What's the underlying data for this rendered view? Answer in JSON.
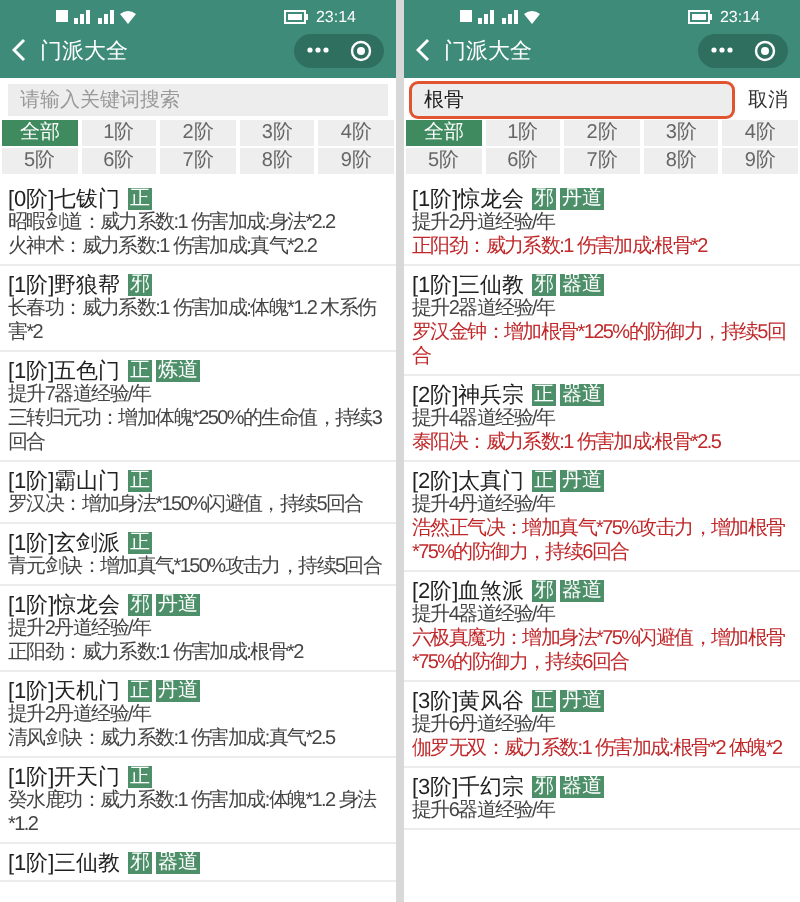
{
  "screens": [
    {
      "status_bar": {
        "time": "23:14"
      },
      "title": "门派大全",
      "search": {
        "placeholder": "请输入关键词搜索"
      },
      "tiers": [
        {
          "label": "全部",
          "selected": true
        },
        {
          "label": "1阶",
          "selected": false
        },
        {
          "label": "2阶",
          "selected": false
        },
        {
          "label": "3阶",
          "selected": false
        },
        {
          "label": "4阶",
          "selected": false
        },
        {
          "label": "5阶",
          "selected": false
        },
        {
          "label": "6阶",
          "selected": false
        },
        {
          "label": "7阶",
          "selected": false
        },
        {
          "label": "8阶",
          "selected": false
        },
        {
          "label": "9阶",
          "selected": false
        }
      ],
      "sects": [
        {
          "title": "[0阶]七钹门",
          "tags": [
            "正"
          ],
          "lines": [
            {
              "text": "昭暇剑道：威力系数:1 伤害加成:身法*2.2",
              "highlight": false
            },
            {
              "text": "火神术：威力系数:1 伤害加成:真气*2.2",
              "highlight": false
            }
          ]
        },
        {
          "title": "[1阶]野狼帮",
          "tags": [
            "邪"
          ],
          "lines": [
            {
              "text": "长春功：威力系数:1 伤害加成:体魄*1.2 木系伤害*2",
              "highlight": false
            }
          ]
        },
        {
          "title": "[1阶]五色门",
          "tags": [
            "正",
            "炼道"
          ],
          "lines": [
            {
              "text": "提升7器道经验/年",
              "highlight": false
            },
            {
              "text": "三转归元功：增加体魄*250%的生命值，持续3回合",
              "highlight": false
            }
          ]
        },
        {
          "title": "[1阶]霸山门",
          "tags": [
            "正"
          ],
          "lines": [
            {
              "text": "罗汉决：增加身法*150%闪避值，持续5回合",
              "highlight": false
            }
          ]
        },
        {
          "title": "[1阶]玄剑派",
          "tags": [
            "正"
          ],
          "lines": [
            {
              "text": "青元剑诀：增加真气*150%攻击力，持续5回合",
              "highlight": false
            }
          ]
        },
        {
          "title": "[1阶]惊龙会",
          "tags": [
            "邪",
            "丹道"
          ],
          "lines": [
            {
              "text": "提升2丹道经验/年",
              "highlight": false
            },
            {
              "text": "正阳劲：威力系数:1 伤害加成:根骨*2",
              "highlight": false
            }
          ]
        },
        {
          "title": "[1阶]天机门",
          "tags": [
            "正",
            "丹道"
          ],
          "lines": [
            {
              "text": "提升2丹道经验/年",
              "highlight": false
            },
            {
              "text": "清风剑诀：威力系数:1 伤害加成:真气*2.5",
              "highlight": false
            }
          ]
        },
        {
          "title": "[1阶]开天门",
          "tags": [
            "正"
          ],
          "lines": [
            {
              "text": "癸水鹿功：威力系数:1 伤害加成:体魄*1.2 身法*1.2",
              "highlight": false
            }
          ]
        },
        {
          "title": "[1阶]三仙教",
          "tags": [
            "邪",
            "器道"
          ]
        }
      ]
    },
    {
      "status_bar": {
        "time": "23:14"
      },
      "title": "门派大全",
      "search": {
        "value": "根骨",
        "focused": true,
        "cancel": "取消"
      },
      "tiers": [
        {
          "label": "全部",
          "selected": true
        },
        {
          "label": "1阶",
          "selected": false
        },
        {
          "label": "2阶",
          "selected": false
        },
        {
          "label": "3阶",
          "selected": false
        },
        {
          "label": "4阶",
          "selected": false
        },
        {
          "label": "5阶",
          "selected": false
        },
        {
          "label": "6阶",
          "selected": false
        },
        {
          "label": "7阶",
          "selected": false
        },
        {
          "label": "8阶",
          "selected": false
        },
        {
          "label": "9阶",
          "selected": false
        }
      ],
      "sects": [
        {
          "title": "[1阶]惊龙会",
          "tags": [
            "邪",
            "丹道"
          ],
          "lines": [
            {
              "text": "提升2丹道经验/年",
              "highlight": false
            },
            {
              "text": "正阳劲：威力系数:1 伤害加成:根骨*2",
              "highlight": true
            }
          ]
        },
        {
          "title": "[1阶]三仙教",
          "tags": [
            "邪",
            "器道"
          ],
          "lines": [
            {
              "text": "提升2器道经验/年",
              "highlight": false
            },
            {
              "text": "罗汉金钟：增加根骨*125%的防御力，持续5回合",
              "highlight": true
            }
          ]
        },
        {
          "title": "[2阶]神兵宗",
          "tags": [
            "正",
            "器道"
          ],
          "lines": [
            {
              "text": "提升4器道经验/年",
              "highlight": false
            },
            {
              "text": "泰阳决：威力系数:1 伤害加成:根骨*2.5",
              "highlight": true
            }
          ]
        },
        {
          "title": "[2阶]太真门",
          "tags": [
            "正",
            "丹道"
          ],
          "lines": [
            {
              "text": "提升4丹道经验/年",
              "highlight": false
            },
            {
              "text": "浩然正气决：增加真气*75%攻击力，增加根骨*75%的防御力，持续6回合",
              "highlight": true
            }
          ]
        },
        {
          "title": "[2阶]血煞派",
          "tags": [
            "邪",
            "器道"
          ],
          "lines": [
            {
              "text": "提升4器道经验/年",
              "highlight": false
            },
            {
              "text": "六极真魔功：增加身法*75%闪避值，增加根骨*75%的防御力，持续6回合",
              "highlight": true
            }
          ]
        },
        {
          "title": "[3阶]黄风谷",
          "tags": [
            "正",
            "丹道"
          ],
          "lines": [
            {
              "text": "提升6丹道经验/年",
              "highlight": false
            },
            {
              "text": "伽罗无双：威力系数:1 伤害加成:根骨*2 体魄*2",
              "highlight": true
            }
          ]
        },
        {
          "title": "[3阶]千幻宗",
          "tags": [
            "邪",
            "器道"
          ],
          "lines": [
            {
              "text": "提升6器道经验/年",
              "highlight": false
            }
          ]
        }
      ]
    }
  ]
}
